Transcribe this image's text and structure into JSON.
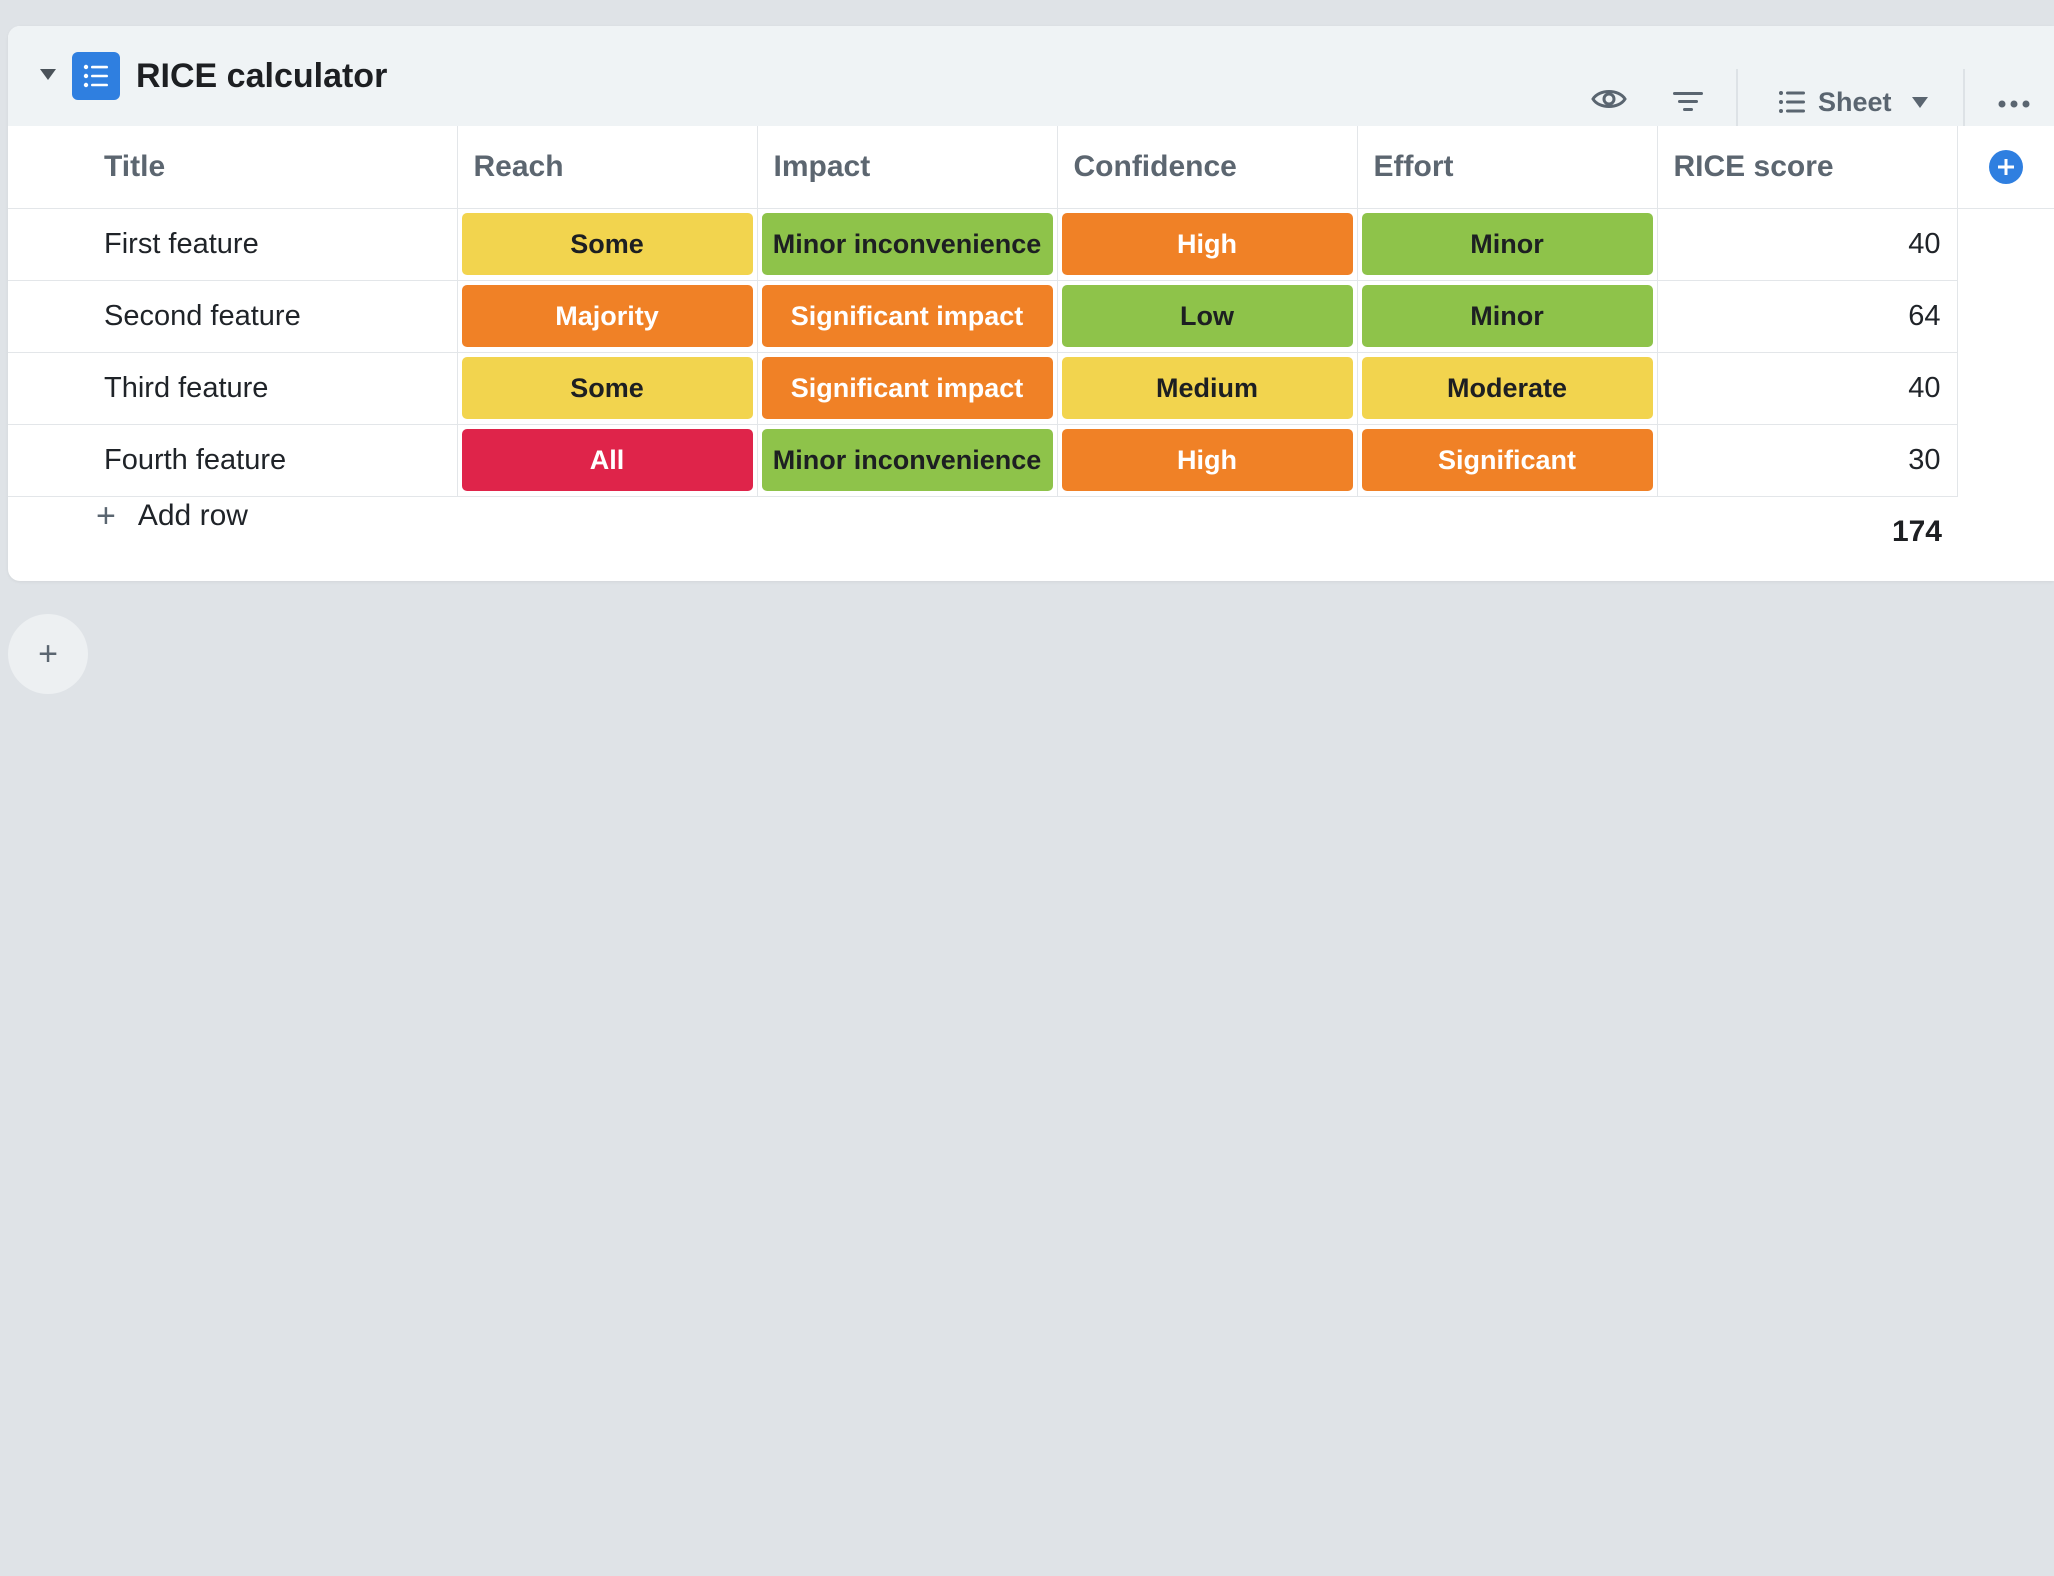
{
  "view": {
    "title": "RICE calculator",
    "icon": "list-icon",
    "layout_label": "Sheet"
  },
  "columns": [
    {
      "key": "title",
      "label": "Title"
    },
    {
      "key": "reach",
      "label": "Reach"
    },
    {
      "key": "impact",
      "label": "Impact"
    },
    {
      "key": "confidence",
      "label": "Confidence"
    },
    {
      "key": "effort",
      "label": "Effort"
    },
    {
      "key": "score",
      "label": "RICE score"
    }
  ],
  "colors": {
    "yellow": "#f2d44e",
    "orange": "#f08126",
    "green": "#8ec34a",
    "red": "#df244a",
    "accent": "#2f7fe0"
  },
  "rows": [
    {
      "title": "First feature",
      "reach": {
        "label": "Some",
        "color": "#f2d44e",
        "text": "#1d1f22"
      },
      "impact": {
        "label": "Minor inconvenience",
        "color": "#8ec34a",
        "text": "#1d1f22"
      },
      "confidence": {
        "label": "High",
        "color": "#f08126",
        "text": "#ffffff"
      },
      "effort": {
        "label": "Minor",
        "color": "#8ec34a",
        "text": "#1d1f22"
      },
      "score": "40"
    },
    {
      "title": "Second feature",
      "reach": {
        "label": "Majority",
        "color": "#f08126",
        "text": "#ffffff"
      },
      "impact": {
        "label": "Significant impact",
        "color": "#f08126",
        "text": "#ffffff"
      },
      "confidence": {
        "label": "Low",
        "color": "#8ec34a",
        "text": "#1d1f22"
      },
      "effort": {
        "label": "Minor",
        "color": "#8ec34a",
        "text": "#1d1f22"
      },
      "score": "64"
    },
    {
      "title": "Third feature",
      "reach": {
        "label": "Some",
        "color": "#f2d44e",
        "text": "#1d1f22"
      },
      "impact": {
        "label": "Significant impact",
        "color": "#f08126",
        "text": "#ffffff"
      },
      "confidence": {
        "label": "Medium",
        "color": "#f2d44e",
        "text": "#1d1f22"
      },
      "effort": {
        "label": "Moderate",
        "color": "#f2d44e",
        "text": "#1d1f22"
      },
      "score": "40"
    },
    {
      "title": "Fourth feature",
      "reach": {
        "label": "All",
        "color": "#df244a",
        "text": "#ffffff"
      },
      "impact": {
        "label": "Minor inconvenience",
        "color": "#8ec34a",
        "text": "#1d1f22"
      },
      "confidence": {
        "label": "High",
        "color": "#f08126",
        "text": "#ffffff"
      },
      "effort": {
        "label": "Significant",
        "color": "#f08126",
        "text": "#ffffff"
      },
      "score": "30"
    }
  ],
  "footer": {
    "add_row_label": "Add row",
    "add_row_icon": "plus-icon",
    "total": "174"
  }
}
